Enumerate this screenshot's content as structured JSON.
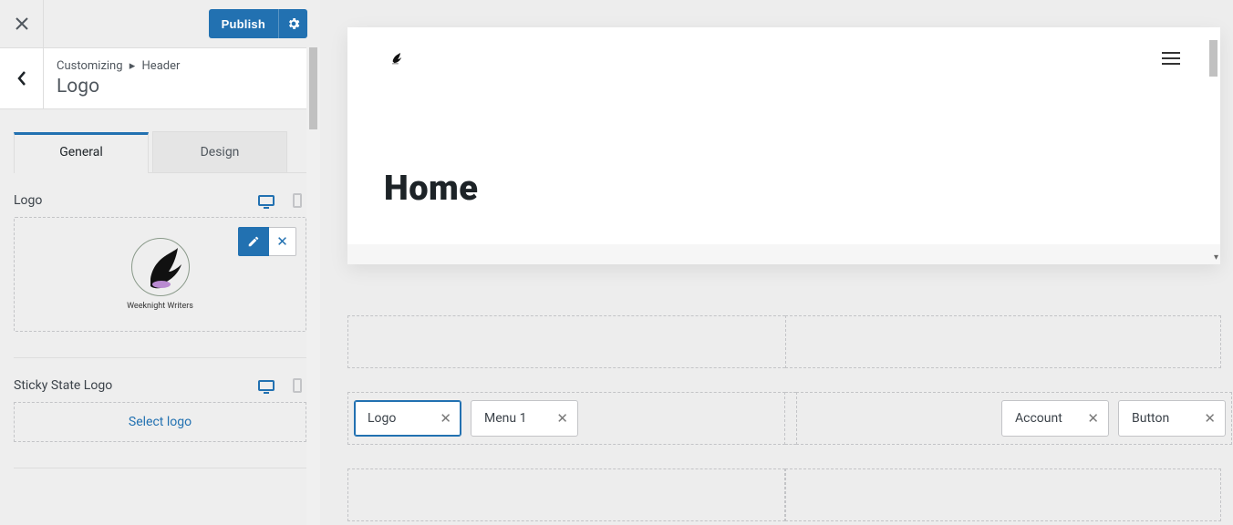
{
  "topbar": {
    "publish": "Publish"
  },
  "breadcrumb": {
    "root": "Customizing",
    "section": "Header",
    "title": "Logo"
  },
  "tabs": {
    "general": "General",
    "design": "Design"
  },
  "logo_section": {
    "label": "Logo",
    "caption": "Weeknight Writers"
  },
  "sticky_section": {
    "label": "Sticky State Logo",
    "select": "Select logo"
  },
  "preview": {
    "page_title": "Home"
  },
  "builder": {
    "chips": {
      "logo": "Logo",
      "menu1": "Menu 1",
      "account": "Account",
      "button": "Button"
    }
  }
}
